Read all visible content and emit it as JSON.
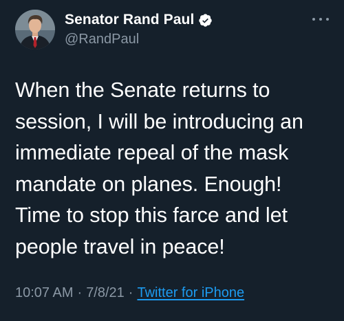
{
  "user": {
    "display_name": "Senator Rand Paul",
    "handle": "@RandPaul",
    "verified": true,
    "avatar_icon": "profile-photo"
  },
  "menu": {
    "icon": "more-horizontal-icon"
  },
  "tweet": {
    "lines": [
      "When the Senate returns to",
      "session, I will be introducing an",
      "immediate repeal of the mask",
      "mandate on planes. Enough!",
      "Time to stop this farce and let",
      "people travel in peace!"
    ]
  },
  "meta": {
    "time": "10:07 AM",
    "separator": "·",
    "date": "7/8/21",
    "source": "Twitter for iPhone"
  },
  "colors": {
    "background": "#15202b",
    "text": "#ffffff",
    "secondary": "#8b98a5",
    "link": "#1d9bf0"
  }
}
